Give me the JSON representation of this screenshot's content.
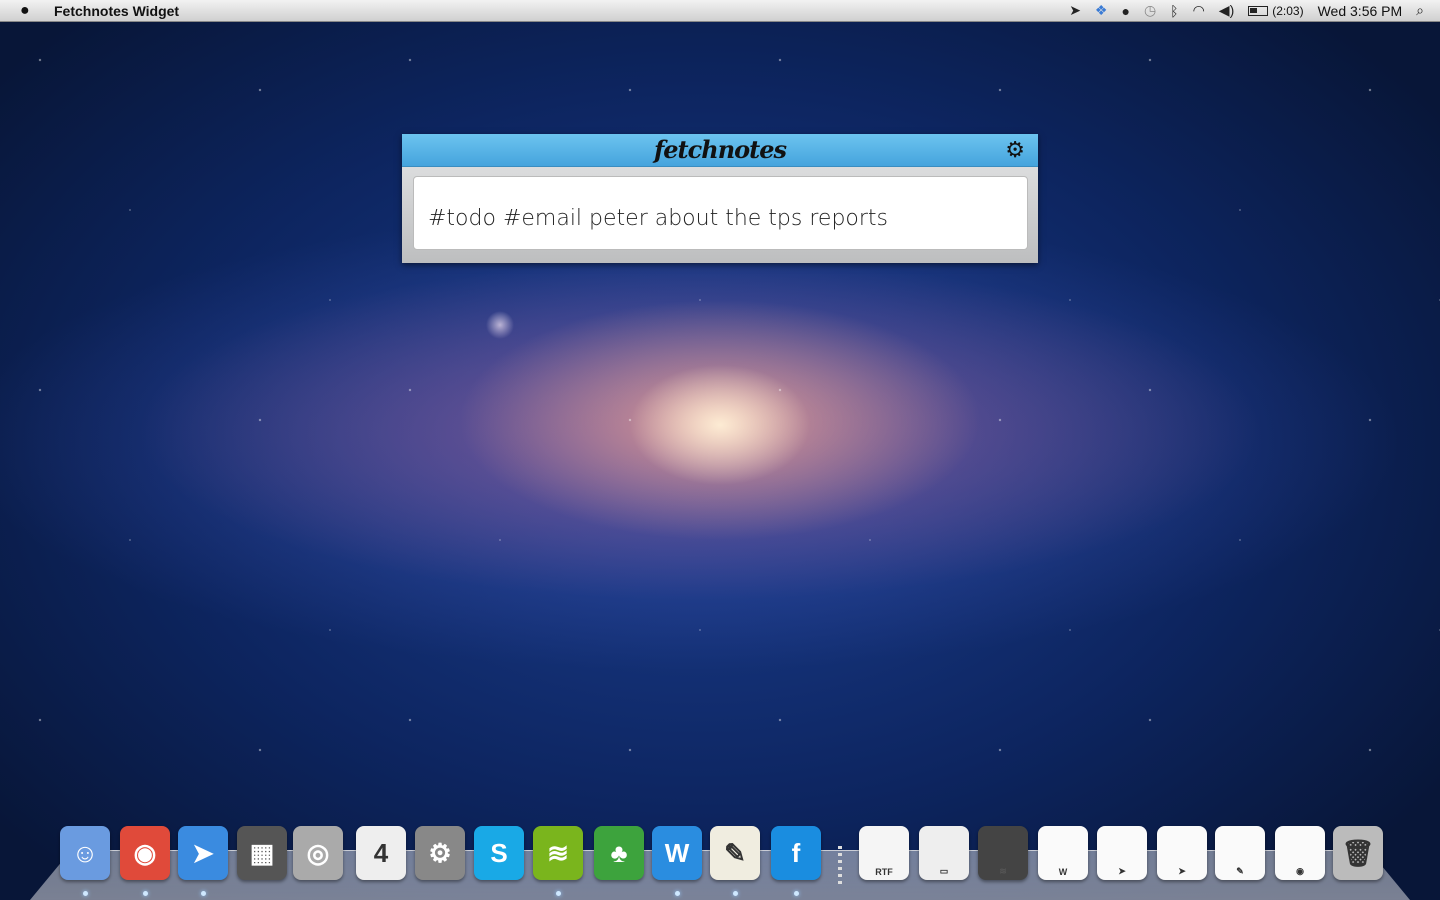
{
  "menubar": {
    "app_name": "Fetchnotes Widget",
    "battery": "(2:03)",
    "clock": "Wed 3:56 PM",
    "status_icons": [
      "sparrow-icon",
      "dropbox-icon",
      "growl-icon",
      "time-machine-icon",
      "bluetooth-icon",
      "wifi-icon",
      "volume-icon",
      "battery-icon"
    ]
  },
  "widget": {
    "logo": "fetchnotes",
    "note_text": "#todo #email peter about the tps reports"
  },
  "dock": {
    "items": [
      {
        "name": "finder",
        "label": "☺",
        "color": "#6a9be0",
        "running": true
      },
      {
        "name": "chrome",
        "label": "◉",
        "color": "#e04a3a",
        "running": true
      },
      {
        "name": "sparrow",
        "label": "➤",
        "color": "#3a8be0",
        "running": true
      },
      {
        "name": "iphoto",
        "label": "▦",
        "color": "#555",
        "running": false
      },
      {
        "name": "facetime",
        "label": "◎",
        "color": "#aaa",
        "running": false
      },
      {
        "name": "ical",
        "label": "4",
        "color": "#eee",
        "running": false
      },
      {
        "name": "system-preferences",
        "label": "⚙",
        "color": "#888",
        "running": false
      },
      {
        "name": "skype",
        "label": "S",
        "color": "#19a9e6",
        "running": false
      },
      {
        "name": "spotify",
        "label": "≋",
        "color": "#7ab51d",
        "running": true
      },
      {
        "name": "adium",
        "label": "♣",
        "color": "#3da33d",
        "running": false
      },
      {
        "name": "word",
        "label": "W",
        "color": "#2a8de0",
        "running": true
      },
      {
        "name": "textedit",
        "label": "✎",
        "color": "#f0ede0",
        "running": true
      },
      {
        "name": "fetchnotes",
        "label": "f",
        "color": "#1a8de0",
        "running": true
      },
      {
        "name": "rtf-document",
        "label": "RTF",
        "color": "#f5f5f5",
        "running": false
      },
      {
        "name": "disk-utility",
        "label": "▭",
        "color": "#eee",
        "running": false
      },
      {
        "name": "spotify-window",
        "label": "≋",
        "color": "#444",
        "running": false
      },
      {
        "name": "word-window",
        "label": "W",
        "color": "#fafafa",
        "running": false
      },
      {
        "name": "sparrow-window",
        "label": "➤",
        "color": "#fafafa",
        "running": false
      },
      {
        "name": "sparrow-window-2",
        "label": "➤",
        "color": "#fafafa",
        "running": false
      },
      {
        "name": "textedit-window",
        "label": "✎",
        "color": "#fafafa",
        "running": false
      },
      {
        "name": "chrome-window",
        "label": "◉",
        "color": "#fafafa",
        "running": false
      },
      {
        "name": "trash",
        "label": "🗑",
        "color": "#bbb",
        "running": false
      }
    ]
  }
}
